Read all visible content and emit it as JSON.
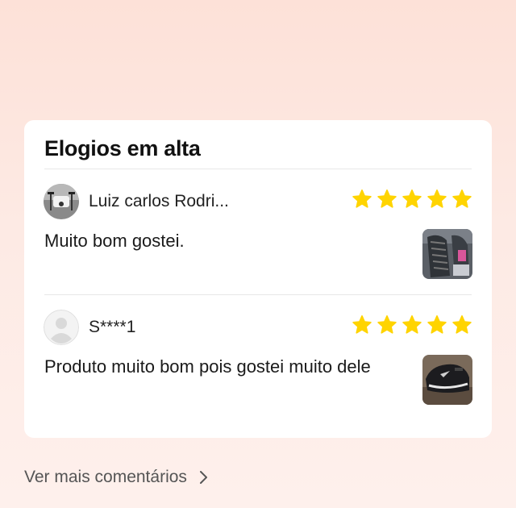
{
  "section": {
    "title": "Elogios em alta"
  },
  "reviews": [
    {
      "name": "Luiz carlos Rodri...",
      "rating": 5,
      "text": "Muito bom gostei.",
      "avatar_icon": "drone-photo-avatar",
      "thumbnail_icon": "shoe-sole-photo"
    },
    {
      "name": "S****1",
      "rating": 5,
      "text": "Produto muito bom pois gostei muito dele",
      "avatar_icon": "default-user-avatar",
      "thumbnail_icon": "black-sneaker-photo"
    }
  ],
  "footer": {
    "more_label": "Ver mais comentários"
  },
  "colors": {
    "star": "#ffd400",
    "background_top": "#fde1d8",
    "card": "#ffffff"
  }
}
